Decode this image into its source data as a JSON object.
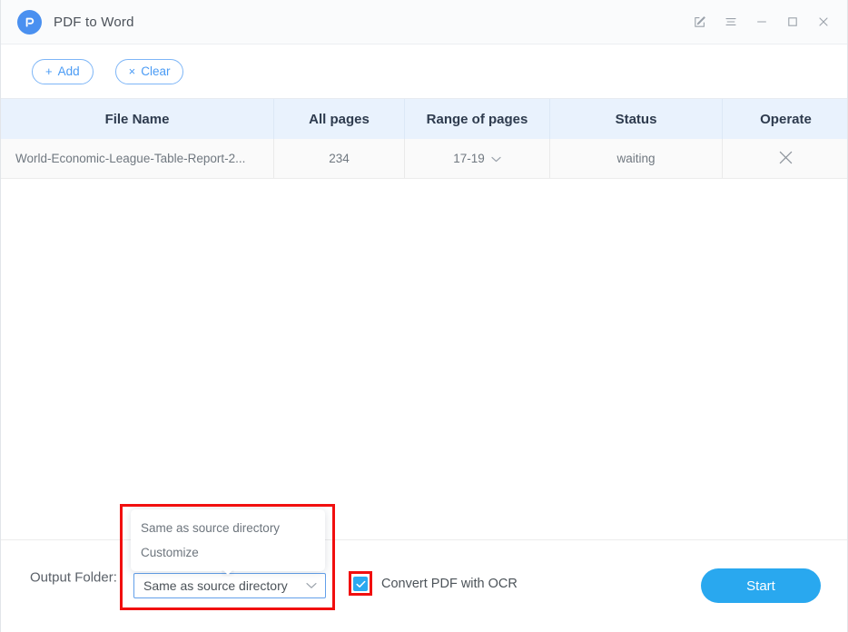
{
  "window": {
    "title": "PDF to Word",
    "logo_icon": "pdfelement-logo-icon",
    "controls": [
      {
        "name": "feedback-icon",
        "label": "Feedback"
      },
      {
        "name": "menu-icon",
        "label": "Menu"
      },
      {
        "name": "minimize-icon",
        "label": "Minimize"
      },
      {
        "name": "maximize-icon",
        "label": "Maximize"
      },
      {
        "name": "close-icon",
        "label": "Close"
      }
    ]
  },
  "toolbar": {
    "add_label": "Add",
    "add_glyph": "+",
    "clear_label": "Clear",
    "clear_glyph": "×"
  },
  "table": {
    "headers": {
      "file_name": "File Name",
      "all_pages": "All pages",
      "range_of_pages": "Range of pages",
      "status": "Status",
      "operate": "Operate"
    },
    "rows": [
      {
        "file_name": "World-Economic-League-Table-Report-2...",
        "all_pages": "234",
        "range_of_pages": "17-19",
        "status": "waiting",
        "operate_icon": "remove-x-icon"
      }
    ]
  },
  "bottom": {
    "output_folder_label": "Output Folder:",
    "output_folder_value": "Same as source directory",
    "output_folder_options": [
      "Same as source directory",
      "Customize"
    ],
    "ocr_label": "Convert PDF with OCR",
    "ocr_checked": true,
    "start_label": "Start"
  },
  "colors": {
    "accent": "#29a8ef",
    "link_blue": "#4a9bf5",
    "header_bg": "#e9f2fd",
    "highlight_red": "#f10f0f",
    "text_dark": "#2e3b4e",
    "text_muted": "#707880"
  }
}
